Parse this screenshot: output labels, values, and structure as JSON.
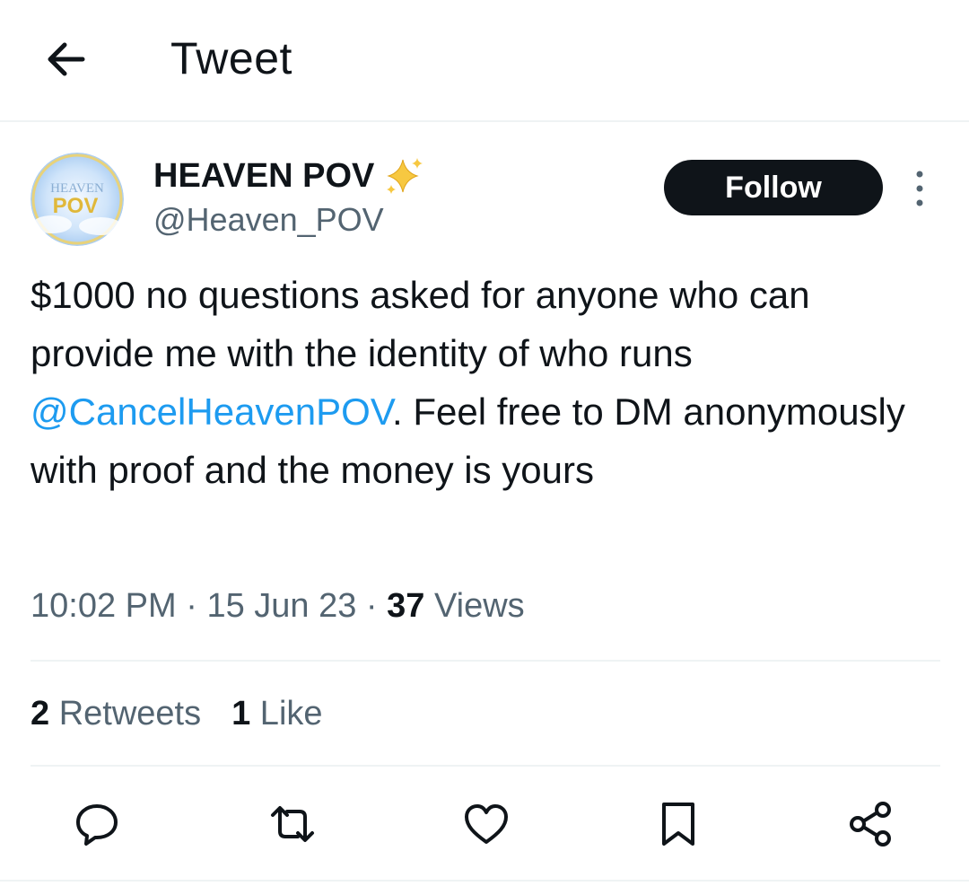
{
  "header": {
    "title": "Tweet",
    "back_icon": "arrow-left-icon"
  },
  "author": {
    "display_name": "HEAVEN POV",
    "emoji": "✨",
    "handle": "@Heaven_POV",
    "avatar_text_top": "HEAVEN",
    "avatar_text_bottom": "POV",
    "follow_label": "Follow"
  },
  "tweet": {
    "text_before": "$1000 no questions asked for anyone who can provide me with the identity of who runs ",
    "mention": "@CancelHeavenPOV",
    "text_after": ". Feel free to DM anonymously with proof and the money is yours",
    "time": "10:02 PM",
    "sep1": " · ",
    "date": "15 Jun 23",
    "sep2": " · ",
    "views_count": "37",
    "views_label": " Views"
  },
  "stats": {
    "retweets_count": "2",
    "retweets_label": " Retweets",
    "likes_count": "1",
    "likes_label": " Like"
  },
  "colors": {
    "accent": "#1d9bf0",
    "text": "#0f1419",
    "muted": "#536471",
    "divider": "#eff3f4"
  },
  "actions": [
    "reply-icon",
    "retweet-icon",
    "like-icon",
    "bookmark-icon",
    "share-icon"
  ]
}
